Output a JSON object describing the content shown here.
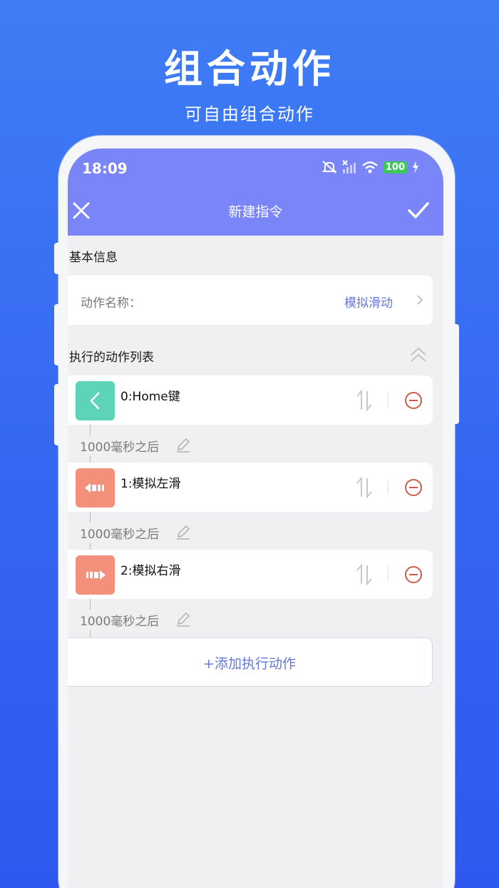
{
  "promo": {
    "title": "组合动作",
    "subtitle": "可自由组合动作"
  },
  "status_bar": {
    "time": "18:09",
    "battery": "100"
  },
  "app_bar": {
    "title": "新建指令",
    "close_icon": "close-icon",
    "confirm_icon": "check-icon"
  },
  "basic_info": {
    "heading": "基本信息",
    "action_name_label": "动作名称：",
    "action_name_value": "模拟滑动"
  },
  "action_list": {
    "heading": "执行的动作列表",
    "items": [
      {
        "label": "0:Home键",
        "tile_color": "#5dd3b7",
        "icon": "back-arrow-icon"
      },
      {
        "label": "1:模拟左滑",
        "tile_color": "#f2907c",
        "icon": "swipe-left-icon"
      },
      {
        "label": "2:模拟右滑",
        "tile_color": "#f2907c",
        "icon": "swipe-right-icon"
      }
    ],
    "delays": [
      "1000毫秒之后",
      "1000毫秒之后",
      "1000毫秒之后"
    ],
    "add_label": "+添加执行动作"
  },
  "colors": {
    "accent": "#7a86f8",
    "link": "#6577d8",
    "remove": "#d05a48"
  }
}
